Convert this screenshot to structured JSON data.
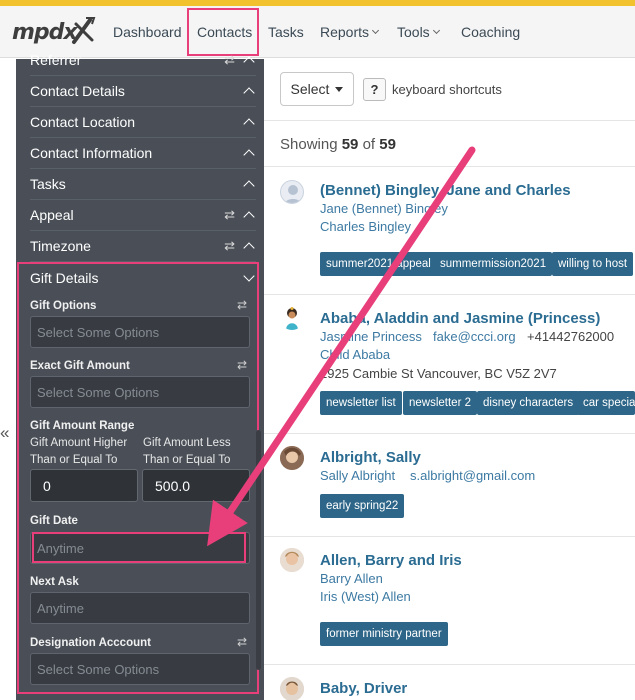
{
  "nav": {
    "logo": "mpdx",
    "items": [
      {
        "label": "Dashboard"
      },
      {
        "label": "Contacts"
      },
      {
        "label": "Tasks"
      },
      {
        "label": "Reports"
      },
      {
        "label": "Tools"
      },
      {
        "label": "Coaching"
      }
    ]
  },
  "sidebar": {
    "filters": [
      {
        "label": "Referrer"
      },
      {
        "label": "Contact Details"
      },
      {
        "label": "Contact Location"
      },
      {
        "label": "Contact Information"
      },
      {
        "label": "Tasks"
      },
      {
        "label": "Appeal"
      },
      {
        "label": "Timezone"
      }
    ],
    "gift_details": {
      "label": "Gift Details",
      "gift_options": {
        "label": "Gift Options",
        "placeholder": "Select Some Options"
      },
      "exact_amount": {
        "label": "Exact Gift Amount",
        "placeholder": "Select Some Options"
      },
      "amount_range": {
        "label": "Gift Amount Range",
        "higher_label_1": "Gift Amount Higher",
        "higher_label_2": "Than or Equal To",
        "higher_value": "0",
        "less_label_1": "Gift Amount Less",
        "less_label_2": "Than or Equal To",
        "less_value": "500.0"
      },
      "gift_date": {
        "label": "Gift Date",
        "placeholder": "Anytime"
      },
      "next_ask": {
        "label": "Next Ask",
        "placeholder": "Anytime"
      },
      "designation": {
        "label": "Designation Acccount",
        "placeholder": "Select Some Options"
      }
    }
  },
  "toolbar": {
    "select_label": "Select",
    "kbd_icon": "?",
    "kbd_label": "keyboard shortcuts"
  },
  "showing": {
    "prefix": "Showing",
    "count": "59",
    "of": "of",
    "total": "59"
  },
  "contacts": [
    {
      "name": "(Bennet) Bingley, Jane and Charles",
      "line1": "Jane (Bennet) Bingley",
      "line2": "Charles Bingley",
      "tags": [
        "summer2021 appeal",
        "summermission2021",
        "willing to host"
      ]
    },
    {
      "name": "Ababa, Aladdin and Jasmine (Princess)",
      "line1": "Jasmine Princess",
      "email": "fake@ccci.org",
      "phone": "+41442762000",
      "line2": "Child Ababa",
      "address": "2925 Cambie St Vancouver, BC V5Z 2V7",
      "tags": [
        "newsletter list",
        "newsletter 2",
        "disney characters",
        "car special"
      ]
    },
    {
      "name": "Albright, Sally",
      "line1": "Sally Albright",
      "email": "s.albright@gmail.com",
      "tags": [
        "early spring22"
      ]
    },
    {
      "name": "Allen, Barry and Iris",
      "line1": "Barry Allen",
      "line2": "Iris (West) Allen",
      "tags": [
        "former ministry partner"
      ]
    },
    {
      "name": "Baby, Driver"
    }
  ],
  "colors": {
    "accent": "#f2c12e",
    "highlight": "#e83e79",
    "sidebar": "#4a4f57",
    "link": "#2b6c92",
    "tag": "#2d6688"
  }
}
